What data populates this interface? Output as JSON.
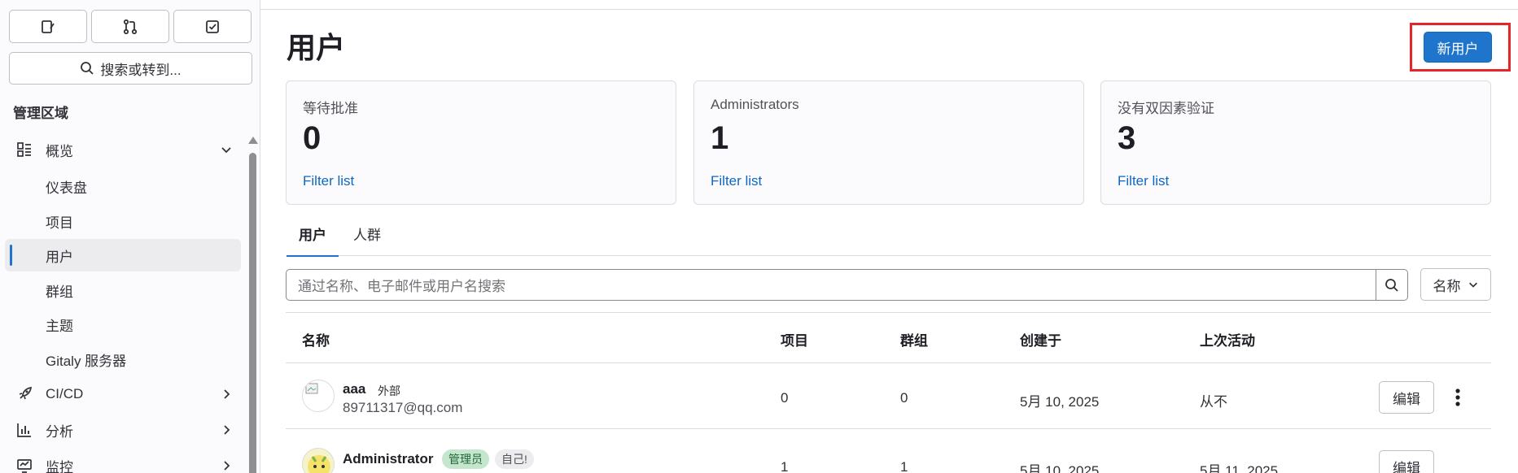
{
  "sidebar": {
    "search_label": "搜索或转到...",
    "section_title": "管理区域",
    "items": [
      {
        "label": "概览",
        "icon": "overview-icon",
        "expandable": "down"
      },
      {
        "label": "仪表盘"
      },
      {
        "label": "项目"
      },
      {
        "label": "用户",
        "active": true
      },
      {
        "label": "群组"
      },
      {
        "label": "主题"
      },
      {
        "label": "Gitaly 服务器"
      },
      {
        "label": "CI/CD",
        "icon": "rocket-icon",
        "expandable": "right"
      },
      {
        "label": "分析",
        "icon": "chart-icon",
        "expandable": "right"
      },
      {
        "label": "监控",
        "icon": "monitor-icon",
        "expandable": "right"
      }
    ]
  },
  "page": {
    "title": "用户",
    "new_user_label": "新用户"
  },
  "stats": [
    {
      "label": "等待批准",
      "value": "0",
      "link": "Filter list"
    },
    {
      "label": "Administrators",
      "value": "1",
      "link": "Filter list"
    },
    {
      "label": "没有双因素验证",
      "value": "3",
      "link": "Filter list"
    }
  ],
  "tabs": [
    {
      "label": "用户",
      "active": true
    },
    {
      "label": "人群"
    }
  ],
  "search": {
    "placeholder": "通过名称、电子邮件或用户名搜索",
    "sort_label": "名称"
  },
  "table": {
    "columns": [
      "名称",
      "项目",
      "群组",
      "创建于",
      "上次活动"
    ],
    "rows": [
      {
        "name": "aaa",
        "tag": "外部",
        "email": "89711317@qq.com",
        "projects": "0",
        "groups": "0",
        "created": "5月 10, 2025",
        "last_activity": "从不",
        "edit_label": "编辑"
      },
      {
        "name": "Administrator",
        "badge_admin": "管理员",
        "badge_self": "自己!",
        "projects": "1",
        "groups": "1",
        "created": "5月 10, 2025",
        "last_activity": "5月 11, 2025",
        "edit_label": "编辑"
      }
    ]
  },
  "colors": {
    "accent": "#1f75cb",
    "highlight_box": "#e3262a",
    "link": "#1068bf"
  }
}
